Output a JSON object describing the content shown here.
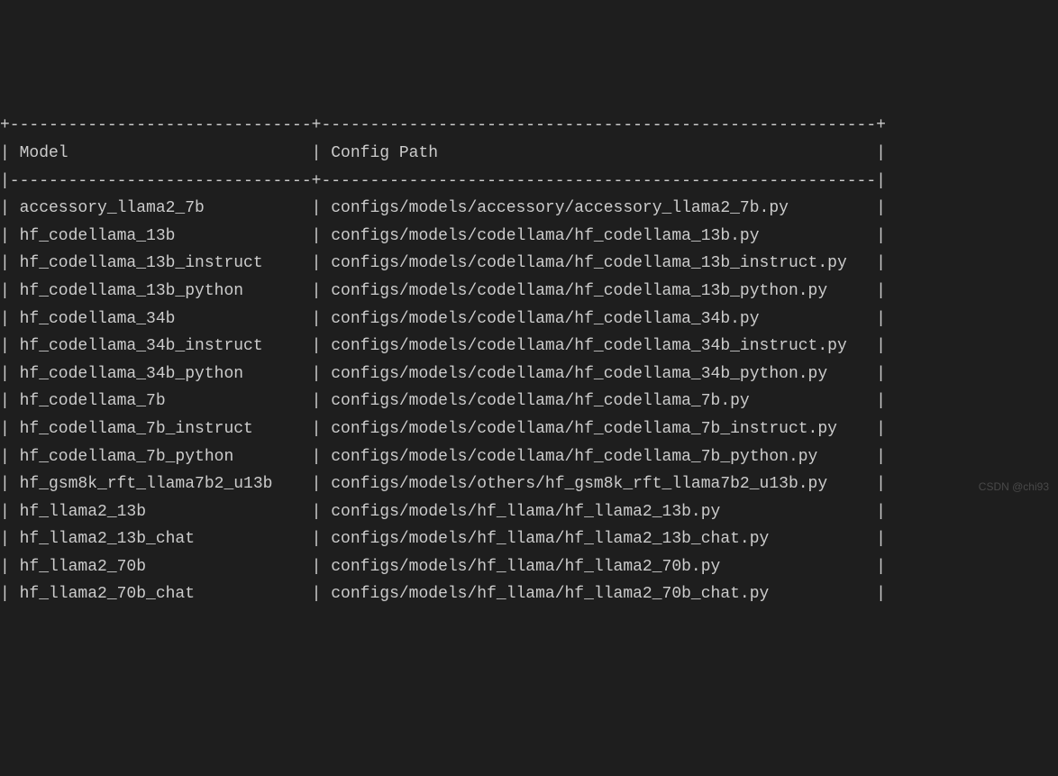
{
  "table": {
    "header": {
      "col1": "Model",
      "col2": "Config Path"
    },
    "rows": [
      {
        "model": "accessory_llama2_7b",
        "path": "configs/models/accessory/accessory_llama2_7b.py"
      },
      {
        "model": "hf_codellama_13b",
        "path": "configs/models/codellama/hf_codellama_13b.py"
      },
      {
        "model": "hf_codellama_13b_instruct",
        "path": "configs/models/codellama/hf_codellama_13b_instruct.py"
      },
      {
        "model": "hf_codellama_13b_python",
        "path": "configs/models/codellama/hf_codellama_13b_python.py"
      },
      {
        "model": "hf_codellama_34b",
        "path": "configs/models/codellama/hf_codellama_34b.py"
      },
      {
        "model": "hf_codellama_34b_instruct",
        "path": "configs/models/codellama/hf_codellama_34b_instruct.py"
      },
      {
        "model": "hf_codellama_34b_python",
        "path": "configs/models/codellama/hf_codellama_34b_python.py"
      },
      {
        "model": "hf_codellama_7b",
        "path": "configs/models/codellama/hf_codellama_7b.py"
      },
      {
        "model": "hf_codellama_7b_instruct",
        "path": "configs/models/codellama/hf_codellama_7b_instruct.py"
      },
      {
        "model": "hf_codellama_7b_python",
        "path": "configs/models/codellama/hf_codellama_7b_python.py"
      },
      {
        "model": "hf_gsm8k_rft_llama7b2_u13b",
        "path": "configs/models/others/hf_gsm8k_rft_llama7b2_u13b.py"
      },
      {
        "model": "hf_llama2_13b",
        "path": "configs/models/hf_llama/hf_llama2_13b.py"
      },
      {
        "model": "hf_llama2_13b_chat",
        "path": "configs/models/hf_llama/hf_llama2_13b_chat.py"
      },
      {
        "model": "hf_llama2_70b",
        "path": "configs/models/hf_llama/hf_llama2_70b.py"
      },
      {
        "model": "hf_llama2_70b_chat",
        "path": "configs/models/hf_llama/hf_llama2_70b_chat.py"
      }
    ]
  },
  "col1_width": 29,
  "col2_width": 55,
  "watermark": "CSDN @chi93"
}
